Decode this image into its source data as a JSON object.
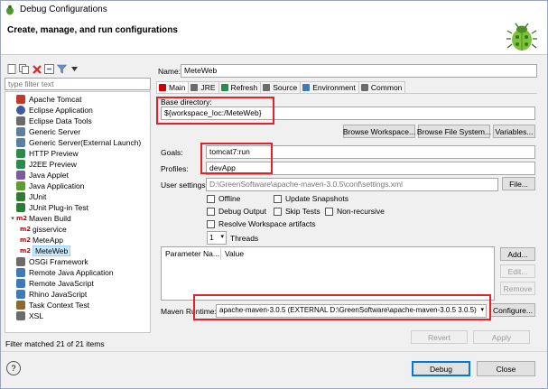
{
  "window": {
    "title": "Debug Configurations",
    "header": "Create, manage, and run configurations"
  },
  "toolbar": {
    "icons": [
      "new-config-icon",
      "duplicate-icon",
      "delete-icon",
      "collapse-icon",
      "filter-icon",
      "dropdown-icon"
    ]
  },
  "filter": {
    "placeholder": "type filter text"
  },
  "tree": [
    {
      "label": "Apache Tomcat",
      "color": "#c0392b"
    },
    {
      "label": "Eclipse Application",
      "color": "#3d5a9e"
    },
    {
      "label": "Eclipse Data Tools",
      "color": "#6b6b6b"
    },
    {
      "label": "Generic Server",
      "color": "#5b7fa5"
    },
    {
      "label": "Generic Server(External Launch)",
      "color": "#5b7fa5"
    },
    {
      "label": "HTTP Preview",
      "color": "#2a8c4a"
    },
    {
      "label": "J2EE Preview",
      "color": "#2a8c4a"
    },
    {
      "label": "Java Applet",
      "color": "#7a5c9e"
    },
    {
      "label": "Java Application",
      "color": "#5aa02c"
    },
    {
      "label": "JUnit",
      "color": "#2e7d32"
    },
    {
      "label": "JUnit Plug-in Test",
      "color": "#2e7d32"
    },
    {
      "label": "Maven Build",
      "color": "#c00"
    },
    {
      "label": "gisservice",
      "color": "#c00"
    },
    {
      "label": "MeteApp",
      "color": "#c00"
    },
    {
      "label": "MeteWeb",
      "color": "#c00"
    },
    {
      "label": "OSGi Framework",
      "color": "#6b6b6b"
    },
    {
      "label": "Remote Java Application",
      "color": "#3d7ab8"
    },
    {
      "label": "Remote JavaScript",
      "color": "#3d7ab8"
    },
    {
      "label": "Rhino JavaScript",
      "color": "#3d7ab8"
    },
    {
      "label": "Task Context Test",
      "color": "#8a6a2e"
    },
    {
      "label": "XSL",
      "color": "#6b6b6b"
    }
  ],
  "filter_status": "Filter matched 21 of 21 items",
  "form": {
    "name_label": "Name:",
    "name_value": "MeteWeb",
    "tabs": [
      {
        "label": "Main",
        "color": "#c00"
      },
      {
        "label": "JRE",
        "color": "#6b6b6b"
      },
      {
        "label": "Refresh",
        "color": "#2a8c4a"
      },
      {
        "label": "Source",
        "color": "#6b6b6b"
      },
      {
        "label": "Environment",
        "color": "#3d7ab8"
      },
      {
        "label": "Common",
        "color": "#6b6b6b"
      }
    ],
    "base_dir_label": "Base directory:",
    "base_dir_value": "${workspace_loc:/MeteWeb}",
    "browse_workspace": "Browse Workspace...",
    "browse_fs": "Browse File System...",
    "variables": "Variables...",
    "goals_label": "Goals:",
    "goals_value": "tomcat7:run",
    "profiles_label": "Profiles:",
    "profiles_value": "devApp",
    "user_settings_label": "User settings:",
    "user_settings_value": "D:\\GreenSoftware\\apache-maven-3.0.5\\conf\\settings.xml",
    "file_btn": "File...",
    "offline": "Offline",
    "update_snapshots": "Update Snapshots",
    "debug_output": "Debug Output",
    "skip_tests": "Skip Tests",
    "non_recursive": "Non-recursive",
    "resolve_ws": "Resolve Workspace artifacts",
    "threads_value": "1",
    "threads_label": "Threads",
    "param_col_name": "Parameter Na...",
    "param_col_value": "Value",
    "add_btn": "Add...",
    "edit_btn": "Edit...",
    "remove_btn": "Remove",
    "runtime_label": "Maven Runtime:",
    "runtime_value": "apache-maven-3.0.5 (EXTERNAL D:\\GreenSoftware\\apache-maven-3.0.5 3.0.5)",
    "configure_btn": "Configure...",
    "revert_btn": "Revert",
    "apply_btn": "Apply"
  },
  "footer": {
    "debug_btn": "Debug",
    "close_btn": "Close",
    "help": "?"
  },
  "colors": {
    "highlight": "#e0222a",
    "selection": "#cce8ff"
  }
}
